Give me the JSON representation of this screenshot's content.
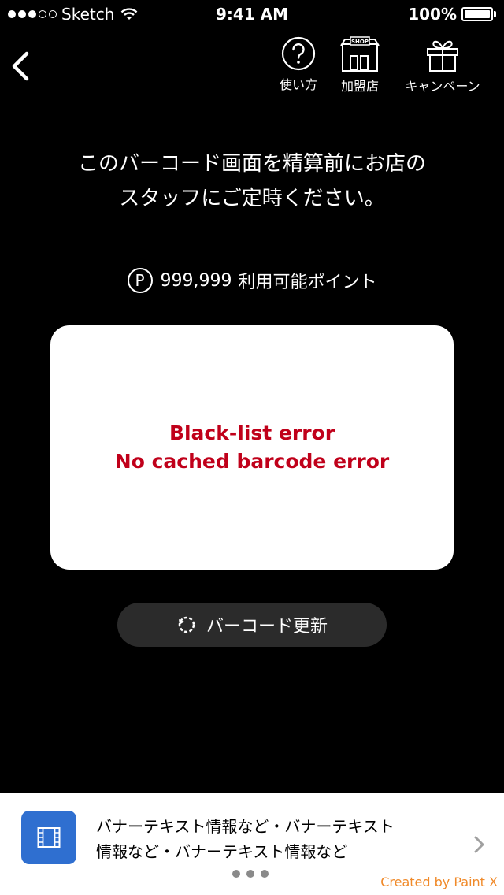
{
  "status_bar": {
    "carrier": "Sketch",
    "time": "9:41 AM",
    "battery": "100%",
    "battery_level": 1.0,
    "signal_bars_filled": 3,
    "signal_bars_total": 5
  },
  "nav": {
    "help_label": "使い方",
    "shop_label": "加盟店",
    "shop_sign": "SHOP",
    "campaign_label": "キャンペーン"
  },
  "instruction": {
    "line1": "このバーコード画面を精算前にお店の",
    "line2": "スタッフにご定時ください。"
  },
  "points": {
    "icon_letter": "P",
    "value": "999,999",
    "label": "利用可能ポイント"
  },
  "barcode_card": {
    "error_line1": "Black-list error",
    "error_line2": "No cached barcode error",
    "error_color": "#c0001a"
  },
  "refresh_button": {
    "label": "バーコード更新"
  },
  "banner": {
    "line1": "バナーテキスト情報など・バナーテキスト",
    "line2": "情報など・バナーテキスト情報など",
    "icon": "film-icon",
    "icon_color": "#2f6fd0",
    "page_count": 3,
    "credit": "Created by Paint X",
    "credit_color": "#f08a2a"
  }
}
